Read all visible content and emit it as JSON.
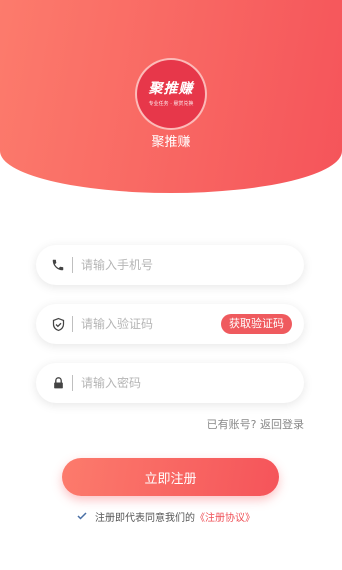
{
  "header": {
    "logo_text": "聚推赚",
    "logo_subtitle": "专业任务 · 悬赏兑换",
    "app_name": "聚推赚"
  },
  "form": {
    "phone": {
      "placeholder": "请输入手机号",
      "value": ""
    },
    "code": {
      "placeholder": "请输入验证码",
      "value": "",
      "get_code_label": "获取验证码"
    },
    "password": {
      "placeholder": "请输入密码",
      "value": ""
    }
  },
  "login_link": "已有账号? 返回登录",
  "register_button": "立即注册",
  "agreement": {
    "checked": true,
    "prefix": "注册即代表同意我们的",
    "link_text": "《注册协议》"
  },
  "colors": {
    "brand": "#f5545a",
    "brand_light": "#fc7b6c",
    "link": "#ef4f56"
  },
  "icons": [
    "phone-icon",
    "shield-check-icon",
    "lock-icon",
    "checkmark-icon"
  ]
}
